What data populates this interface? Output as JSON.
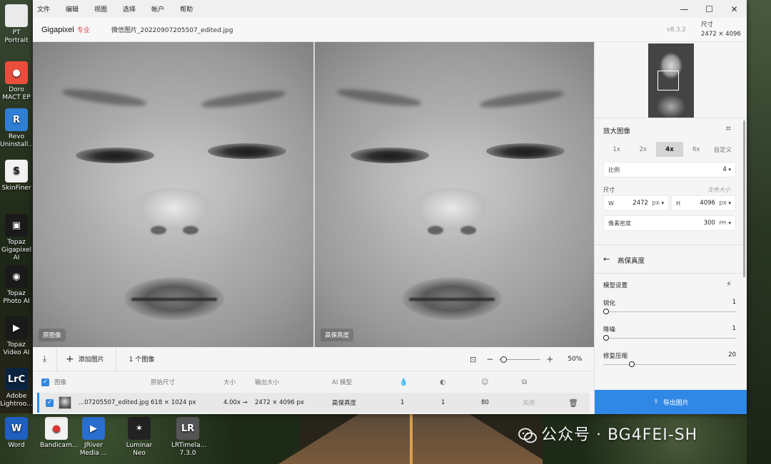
{
  "desktop": {
    "icons_left": [
      {
        "label": "PT Portrait",
        "color": "#eaeaea",
        "glyph": ""
      },
      {
        "label": "Doro MACT EP",
        "color": "#e94e3c",
        "glyph": "●"
      },
      {
        "label": "Revo Uninstall...",
        "color": "#2f7fd4",
        "glyph": "R"
      },
      {
        "label": "SkinFiner",
        "color": "#f2f2f2",
        "glyph": "S"
      },
      {
        "label": "Topaz Gigapixel AI",
        "color": "#1a1a1a",
        "glyph": "▣"
      },
      {
        "label": "Topaz Photo AI",
        "color": "#1a1a1a",
        "glyph": "◉"
      },
      {
        "label": "Topaz Video AI",
        "color": "#1a1a1a",
        "glyph": "▶"
      },
      {
        "label": "Adobe Lightroo...",
        "color": "#0b2540",
        "glyph": "LrC"
      }
    ],
    "icons_bottom": [
      {
        "label": "Word",
        "color": "#1f5fbf",
        "glyph": "W"
      },
      {
        "label": "Bandicam...",
        "color": "#f2f2f2",
        "glyph": "●"
      },
      {
        "label": "JRiver Media ...",
        "color": "#2a6fd0",
        "glyph": "▶"
      },
      {
        "label": "Luminar Neo",
        "color": "#222",
        "glyph": "✶"
      },
      {
        "label": "LRTimela... 7.3.0",
        "color": "#555",
        "glyph": "LR"
      }
    ],
    "watermark": "公众号 · BG4FEI-SH"
  },
  "menu": {
    "items": [
      "文件",
      "编辑",
      "视图",
      "选择",
      "帐户",
      "帮助"
    ]
  },
  "window_controls": {
    "minimize": "—",
    "maximize": "☐",
    "close": "✕"
  },
  "header": {
    "brand": "Gigapixel",
    "brand_badge": "专业",
    "filename": "微信图片_20220907205507_edited.jpg",
    "version": "v8.3.2",
    "size_label": "尺寸",
    "size_value": "2472 × 4096"
  },
  "preview": {
    "left_label": "原图像",
    "right_label": "高保真度"
  },
  "toolbar": {
    "add_label": "添加图片",
    "count_label": "1 个图像",
    "zoom_value": "50%",
    "zoom_percent": 50
  },
  "table": {
    "headers": {
      "image": "图像",
      "original": "原始尺寸",
      "scale": "大小",
      "output": "输出大小",
      "model": "AI 模型"
    },
    "row": {
      "name": "...07205507_edited.jpg",
      "original": "618 × 1024 px",
      "scale": "4.00x →",
      "output": "2472 × 4096 px",
      "model": "高保真度",
      "v1": "1",
      "v2": "1",
      "v3": "80",
      "status": "关闭"
    }
  },
  "sidebar": {
    "upscale_title": "放大图像",
    "scale_options": [
      "1x",
      "2x",
      "4x",
      "6x",
      "自定义"
    ],
    "selected_scale": "4x",
    "ratio_label": "比例",
    "ratio_value": "4",
    "size_label": "尺寸",
    "doc_size_link": "文件大小",
    "width_label": "W",
    "width_value": "2472",
    "width_unit": "px",
    "height_label": "H",
    "height_value": "4096",
    "height_unit": "px",
    "density_label": "像素密度",
    "density_value": "300",
    "density_unit": "PPI",
    "model_back_label": "高保真度",
    "model_settings_label": "模型设置",
    "sharpen_label": "锐化",
    "sharpen_value": "1",
    "sharpen_level": 0.0,
    "denoise_label": "降噪",
    "denoise_value": "1",
    "denoise_level": 0.0,
    "compress_label": "修复压缩",
    "compress_value": "20",
    "compress_level": 0.2,
    "export_label": "导出图片"
  },
  "colors": {
    "accent": "#2f87e6",
    "brand_badge": "#e0434a"
  }
}
